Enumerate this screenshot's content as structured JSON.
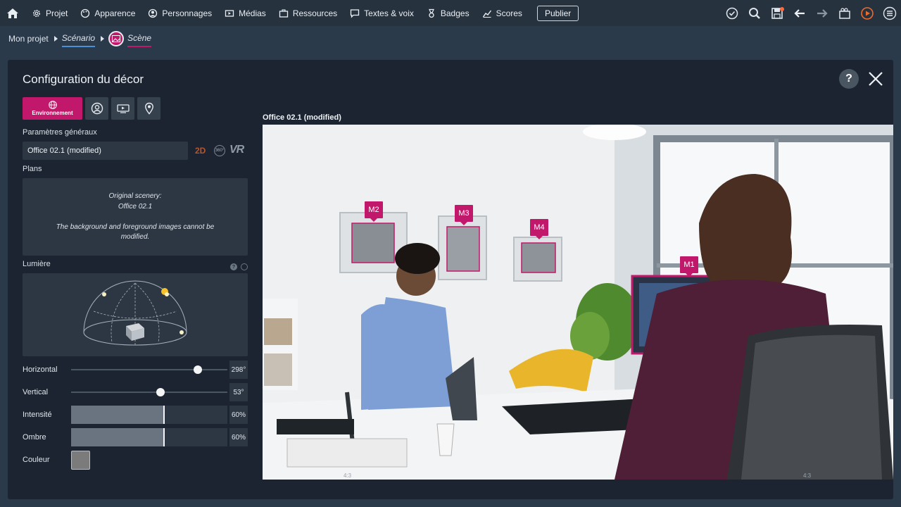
{
  "nav": {
    "items": [
      {
        "label": "Projet",
        "icon": "gear-icon"
      },
      {
        "label": "Apparence",
        "icon": "palette-icon"
      },
      {
        "label": "Personnages",
        "icon": "character-icon"
      },
      {
        "label": "Médias",
        "icon": "media-icon"
      },
      {
        "label": "Ressources",
        "icon": "briefcase-icon"
      },
      {
        "label": "Textes & voix",
        "icon": "speech-icon"
      },
      {
        "label": "Badges",
        "icon": "badge-icon"
      },
      {
        "label": "Scores",
        "icon": "chart-icon"
      }
    ],
    "publish_label": "Publier",
    "right_icons": [
      "check-icon",
      "search-icon",
      "save-icon",
      "back-arrow-icon",
      "forward-arrow-icon",
      "camera-icon",
      "play-icon",
      "menu-icon"
    ]
  },
  "breadcrumb": {
    "project": "Mon projet",
    "scenario": "Scénario",
    "scene": "Scène"
  },
  "panel": {
    "title": "Configuration du décor",
    "tabs": {
      "environment_label": "Environnement",
      "others": [
        "character-tab-icon",
        "media-tab-icon",
        "location-tab-icon"
      ]
    },
    "general": {
      "label": "Paramètres généraux",
      "scenery_name": "Office 02.1 (modified)",
      "mode_2d": "2D",
      "mode_360": "360°",
      "mode_vr": "VR"
    },
    "plans": {
      "label": "Plans",
      "line1": "Original scenery:",
      "line2": "Office 02.1",
      "line3": "The background and foreground images cannot be modified."
    },
    "light": {
      "label": "Lumière",
      "horizontal_label": "Horizontal",
      "horizontal_value": "298°",
      "horizontal_fraction": 0.81,
      "vertical_label": "Vertical",
      "vertical_value": "53°",
      "vertical_fraction": 0.57,
      "intensity_label": "Intensité",
      "intensity_value": "60%",
      "intensity_fraction": 0.6,
      "shadow_label": "Ombre",
      "shadow_value": "60%",
      "shadow_fraction": 0.6,
      "color_label": "Couleur",
      "color": "#7b7b7b"
    }
  },
  "viewport": {
    "title": "Office 02.1 (modified)",
    "markers": [
      "M2",
      "M3",
      "M4",
      "M1"
    ],
    "ratio_left": "4:3",
    "ratio_right": "4:3"
  },
  "colors": {
    "accent": "#c2186b",
    "panel_bg": "#1b2430",
    "nav_bg": "#27323f"
  }
}
